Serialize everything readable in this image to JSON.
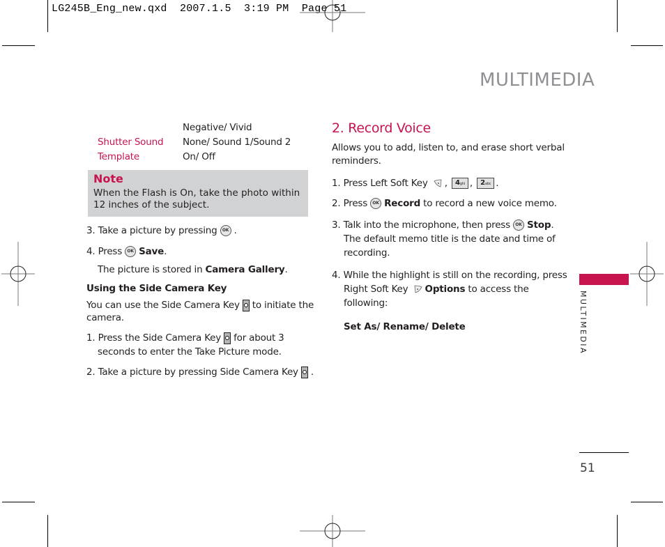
{
  "slug": "LG245B_Eng_new.qxd  2007.1.5  3:19 PM  Page 51",
  "section_title": "MULTIMEDIA",
  "left_column": {
    "settings_table": [
      {
        "label": "",
        "value": "Negative/ Vivid"
      },
      {
        "label": "Shutter Sound",
        "value": "None/ Sound 1/Sound 2"
      },
      {
        "label": "Template",
        "value": "On/ Off"
      }
    ],
    "note": {
      "title": "Note",
      "text": "When the Flash is On, take the photo within 12 inches of the subject."
    },
    "step3": {
      "prefix": "3. Take a picture by pressing",
      "icon": "ok-key-icon",
      "suffix": "."
    },
    "step4": {
      "prefix": "4. Press",
      "icon": "ok-key-icon",
      "bold": "Save",
      "suffix": "."
    },
    "stored": {
      "prefix": "The picture is stored in ",
      "bold": "Camera Gallery",
      "suffix": "."
    },
    "subheading": "Using the Side Camera Key",
    "intro": {
      "prefix": "You can use the Side Camera Key",
      "icon": "side-camera-key-icon",
      "suffix": "to initiate the",
      "line2": "camera."
    },
    "side_steps": [
      {
        "prefix": "1. Press the Side Camera Key",
        "icon": "side-camera-key-icon",
        "suffix": "for about 3",
        "line2": "seconds to enter the Take Picture mode."
      },
      {
        "prefix": "2. Take a picture by pressing Side Camera Key",
        "icon": "side-camera-key-icon",
        "suffix": "."
      }
    ]
  },
  "right_column": {
    "heading": "2. Record Voice",
    "intro_line1": "Allows you to add, listen to, and erase short verbal",
    "intro_line2": "reminders.",
    "step1": {
      "prefix": "1. Press Left Soft Key",
      "keys": [
        "4",
        "ghi",
        "2",
        "abc"
      ]
    },
    "step2": {
      "prefix": "2. Press",
      "bold": "Record",
      "suffix": "to record a new voice memo."
    },
    "step3": {
      "prefix": "3. Talk into the microphone, then press",
      "bold": "Stop",
      "line2": "The default memo title is the date and time of",
      "line3": "recording."
    },
    "step4": {
      "line1": "4. While the highlight is still on the recording, press",
      "prefix2": "Right Soft Key",
      "bold": "Options",
      "suffix2": "to access the",
      "line3": "following:"
    },
    "options": "Set As/ Rename/ Delete"
  },
  "side_tab": {
    "label": "MULTIMEDIA",
    "color": "#c8144e"
  },
  "page_number": "51",
  "colors": {
    "accent": "#c8144e",
    "note_bg": "#d1d2d4",
    "title_gray": "#8e9093"
  }
}
